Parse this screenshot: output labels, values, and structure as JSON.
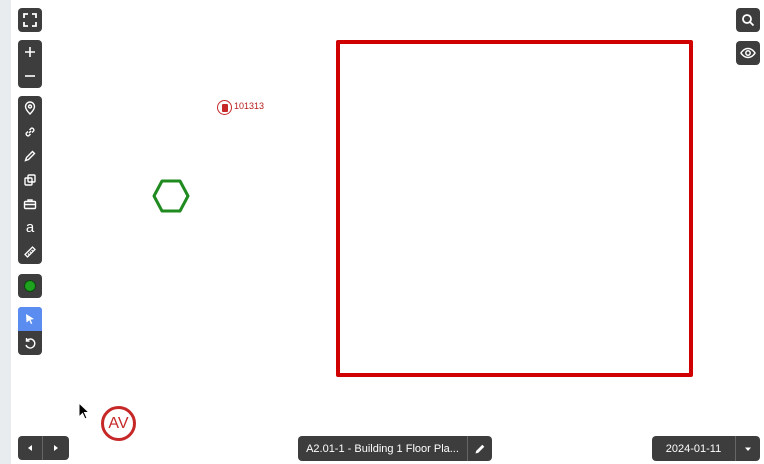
{
  "drawing": {
    "sheet_label": "A2.01-1 - Building 1 Floor Pla...",
    "date": "2024-01-11"
  },
  "markup": {
    "pin_label": "101313",
    "avatar_initials": "AV"
  },
  "colors": {
    "toolbar": "#3d3d3d",
    "active_tool": "#5b8df0",
    "rectangle": "#d00000",
    "hexagon": "#1f8a1f",
    "color_swatch": "#1fa21f",
    "pin": "#c62828"
  },
  "icons": {
    "fullscreen": "fullscreen-icon",
    "zoom_in": "plus-icon",
    "zoom_out": "minus-icon",
    "pin": "map-pin-icon",
    "link": "link-icon",
    "pencil": "pencil-icon",
    "shapes": "shapes-icon",
    "toolbox": "toolbox-icon",
    "text": "text-icon",
    "measure": "ruler-icon",
    "select": "cursor-icon",
    "undo": "undo-icon",
    "search": "search-icon",
    "visibility": "eye-icon",
    "edit": "pencil-icon",
    "dropdown": "caret-down-icon",
    "prev": "caret-left-icon",
    "next": "caret-right-icon"
  },
  "toolbar": {
    "text_tool_glyph": "a"
  }
}
